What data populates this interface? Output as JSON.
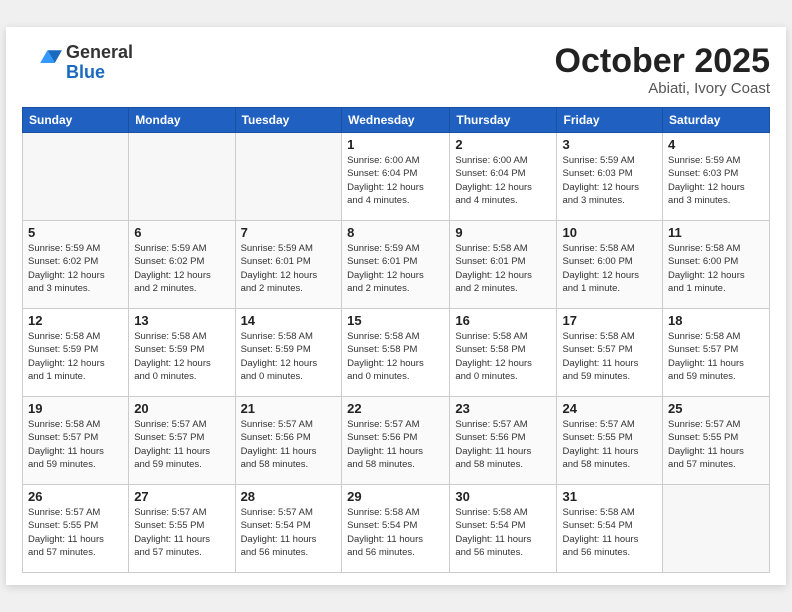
{
  "header": {
    "logo_general": "General",
    "logo_blue": "Blue",
    "month_title": "October 2025",
    "subtitle": "Abiati, Ivory Coast"
  },
  "weekdays": [
    "Sunday",
    "Monday",
    "Tuesday",
    "Wednesday",
    "Thursday",
    "Friday",
    "Saturday"
  ],
  "weeks": [
    [
      {
        "day": "",
        "info": ""
      },
      {
        "day": "",
        "info": ""
      },
      {
        "day": "",
        "info": ""
      },
      {
        "day": "1",
        "info": "Sunrise: 6:00 AM\nSunset: 6:04 PM\nDaylight: 12 hours\nand 4 minutes."
      },
      {
        "day": "2",
        "info": "Sunrise: 6:00 AM\nSunset: 6:04 PM\nDaylight: 12 hours\nand 4 minutes."
      },
      {
        "day": "3",
        "info": "Sunrise: 5:59 AM\nSunset: 6:03 PM\nDaylight: 12 hours\nand 3 minutes."
      },
      {
        "day": "4",
        "info": "Sunrise: 5:59 AM\nSunset: 6:03 PM\nDaylight: 12 hours\nand 3 minutes."
      }
    ],
    [
      {
        "day": "5",
        "info": "Sunrise: 5:59 AM\nSunset: 6:02 PM\nDaylight: 12 hours\nand 3 minutes."
      },
      {
        "day": "6",
        "info": "Sunrise: 5:59 AM\nSunset: 6:02 PM\nDaylight: 12 hours\nand 2 minutes."
      },
      {
        "day": "7",
        "info": "Sunrise: 5:59 AM\nSunset: 6:01 PM\nDaylight: 12 hours\nand 2 minutes."
      },
      {
        "day": "8",
        "info": "Sunrise: 5:59 AM\nSunset: 6:01 PM\nDaylight: 12 hours\nand 2 minutes."
      },
      {
        "day": "9",
        "info": "Sunrise: 5:58 AM\nSunset: 6:01 PM\nDaylight: 12 hours\nand 2 minutes."
      },
      {
        "day": "10",
        "info": "Sunrise: 5:58 AM\nSunset: 6:00 PM\nDaylight: 12 hours\nand 1 minute."
      },
      {
        "day": "11",
        "info": "Sunrise: 5:58 AM\nSunset: 6:00 PM\nDaylight: 12 hours\nand 1 minute."
      }
    ],
    [
      {
        "day": "12",
        "info": "Sunrise: 5:58 AM\nSunset: 5:59 PM\nDaylight: 12 hours\nand 1 minute."
      },
      {
        "day": "13",
        "info": "Sunrise: 5:58 AM\nSunset: 5:59 PM\nDaylight: 12 hours\nand 0 minutes."
      },
      {
        "day": "14",
        "info": "Sunrise: 5:58 AM\nSunset: 5:59 PM\nDaylight: 12 hours\nand 0 minutes."
      },
      {
        "day": "15",
        "info": "Sunrise: 5:58 AM\nSunset: 5:58 PM\nDaylight: 12 hours\nand 0 minutes."
      },
      {
        "day": "16",
        "info": "Sunrise: 5:58 AM\nSunset: 5:58 PM\nDaylight: 12 hours\nand 0 minutes."
      },
      {
        "day": "17",
        "info": "Sunrise: 5:58 AM\nSunset: 5:57 PM\nDaylight: 11 hours\nand 59 minutes."
      },
      {
        "day": "18",
        "info": "Sunrise: 5:58 AM\nSunset: 5:57 PM\nDaylight: 11 hours\nand 59 minutes."
      }
    ],
    [
      {
        "day": "19",
        "info": "Sunrise: 5:58 AM\nSunset: 5:57 PM\nDaylight: 11 hours\nand 59 minutes."
      },
      {
        "day": "20",
        "info": "Sunrise: 5:57 AM\nSunset: 5:57 PM\nDaylight: 11 hours\nand 59 minutes."
      },
      {
        "day": "21",
        "info": "Sunrise: 5:57 AM\nSunset: 5:56 PM\nDaylight: 11 hours\nand 58 minutes."
      },
      {
        "day": "22",
        "info": "Sunrise: 5:57 AM\nSunset: 5:56 PM\nDaylight: 11 hours\nand 58 minutes."
      },
      {
        "day": "23",
        "info": "Sunrise: 5:57 AM\nSunset: 5:56 PM\nDaylight: 11 hours\nand 58 minutes."
      },
      {
        "day": "24",
        "info": "Sunrise: 5:57 AM\nSunset: 5:55 PM\nDaylight: 11 hours\nand 58 minutes."
      },
      {
        "day": "25",
        "info": "Sunrise: 5:57 AM\nSunset: 5:55 PM\nDaylight: 11 hours\nand 57 minutes."
      }
    ],
    [
      {
        "day": "26",
        "info": "Sunrise: 5:57 AM\nSunset: 5:55 PM\nDaylight: 11 hours\nand 57 minutes."
      },
      {
        "day": "27",
        "info": "Sunrise: 5:57 AM\nSunset: 5:55 PM\nDaylight: 11 hours\nand 57 minutes."
      },
      {
        "day": "28",
        "info": "Sunrise: 5:57 AM\nSunset: 5:54 PM\nDaylight: 11 hours\nand 56 minutes."
      },
      {
        "day": "29",
        "info": "Sunrise: 5:58 AM\nSunset: 5:54 PM\nDaylight: 11 hours\nand 56 minutes."
      },
      {
        "day": "30",
        "info": "Sunrise: 5:58 AM\nSunset: 5:54 PM\nDaylight: 11 hours\nand 56 minutes."
      },
      {
        "day": "31",
        "info": "Sunrise: 5:58 AM\nSunset: 5:54 PM\nDaylight: 11 hours\nand 56 minutes."
      },
      {
        "day": "",
        "info": ""
      }
    ]
  ]
}
